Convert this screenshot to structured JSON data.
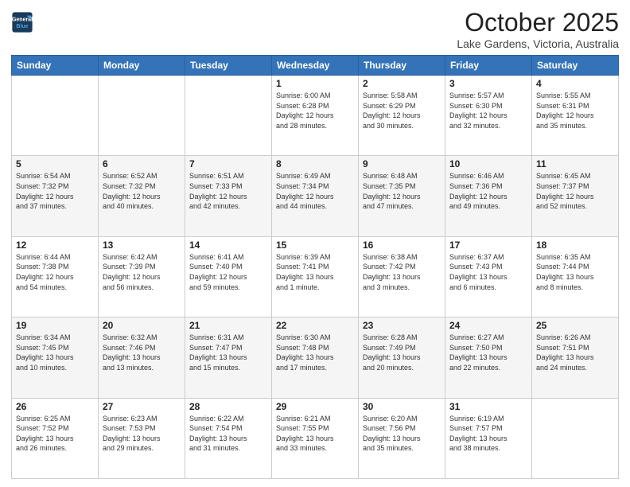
{
  "header": {
    "logo_line1": "General",
    "logo_line2": "Blue",
    "title": "October 2025",
    "subtitle": "Lake Gardens, Victoria, Australia"
  },
  "weekdays": [
    "Sunday",
    "Monday",
    "Tuesday",
    "Wednesday",
    "Thursday",
    "Friday",
    "Saturday"
  ],
  "weeks": [
    [
      {
        "day": "",
        "info": ""
      },
      {
        "day": "",
        "info": ""
      },
      {
        "day": "",
        "info": ""
      },
      {
        "day": "1",
        "info": "Sunrise: 6:00 AM\nSunset: 6:28 PM\nDaylight: 12 hours\nand 28 minutes."
      },
      {
        "day": "2",
        "info": "Sunrise: 5:58 AM\nSunset: 6:29 PM\nDaylight: 12 hours\nand 30 minutes."
      },
      {
        "day": "3",
        "info": "Sunrise: 5:57 AM\nSunset: 6:30 PM\nDaylight: 12 hours\nand 32 minutes."
      },
      {
        "day": "4",
        "info": "Sunrise: 5:55 AM\nSunset: 6:31 PM\nDaylight: 12 hours\nand 35 minutes."
      }
    ],
    [
      {
        "day": "5",
        "info": "Sunrise: 6:54 AM\nSunset: 7:32 PM\nDaylight: 12 hours\nand 37 minutes."
      },
      {
        "day": "6",
        "info": "Sunrise: 6:52 AM\nSunset: 7:32 PM\nDaylight: 12 hours\nand 40 minutes."
      },
      {
        "day": "7",
        "info": "Sunrise: 6:51 AM\nSunset: 7:33 PM\nDaylight: 12 hours\nand 42 minutes."
      },
      {
        "day": "8",
        "info": "Sunrise: 6:49 AM\nSunset: 7:34 PM\nDaylight: 12 hours\nand 44 minutes."
      },
      {
        "day": "9",
        "info": "Sunrise: 6:48 AM\nSunset: 7:35 PM\nDaylight: 12 hours\nand 47 minutes."
      },
      {
        "day": "10",
        "info": "Sunrise: 6:46 AM\nSunset: 7:36 PM\nDaylight: 12 hours\nand 49 minutes."
      },
      {
        "day": "11",
        "info": "Sunrise: 6:45 AM\nSunset: 7:37 PM\nDaylight: 12 hours\nand 52 minutes."
      }
    ],
    [
      {
        "day": "12",
        "info": "Sunrise: 6:44 AM\nSunset: 7:38 PM\nDaylight: 12 hours\nand 54 minutes."
      },
      {
        "day": "13",
        "info": "Sunrise: 6:42 AM\nSunset: 7:39 PM\nDaylight: 12 hours\nand 56 minutes."
      },
      {
        "day": "14",
        "info": "Sunrise: 6:41 AM\nSunset: 7:40 PM\nDaylight: 12 hours\nand 59 minutes."
      },
      {
        "day": "15",
        "info": "Sunrise: 6:39 AM\nSunset: 7:41 PM\nDaylight: 13 hours\nand 1 minute."
      },
      {
        "day": "16",
        "info": "Sunrise: 6:38 AM\nSunset: 7:42 PM\nDaylight: 13 hours\nand 3 minutes."
      },
      {
        "day": "17",
        "info": "Sunrise: 6:37 AM\nSunset: 7:43 PM\nDaylight: 13 hours\nand 6 minutes."
      },
      {
        "day": "18",
        "info": "Sunrise: 6:35 AM\nSunset: 7:44 PM\nDaylight: 13 hours\nand 8 minutes."
      }
    ],
    [
      {
        "day": "19",
        "info": "Sunrise: 6:34 AM\nSunset: 7:45 PM\nDaylight: 13 hours\nand 10 minutes."
      },
      {
        "day": "20",
        "info": "Sunrise: 6:32 AM\nSunset: 7:46 PM\nDaylight: 13 hours\nand 13 minutes."
      },
      {
        "day": "21",
        "info": "Sunrise: 6:31 AM\nSunset: 7:47 PM\nDaylight: 13 hours\nand 15 minutes."
      },
      {
        "day": "22",
        "info": "Sunrise: 6:30 AM\nSunset: 7:48 PM\nDaylight: 13 hours\nand 17 minutes."
      },
      {
        "day": "23",
        "info": "Sunrise: 6:28 AM\nSunset: 7:49 PM\nDaylight: 13 hours\nand 20 minutes."
      },
      {
        "day": "24",
        "info": "Sunrise: 6:27 AM\nSunset: 7:50 PM\nDaylight: 13 hours\nand 22 minutes."
      },
      {
        "day": "25",
        "info": "Sunrise: 6:26 AM\nSunset: 7:51 PM\nDaylight: 13 hours\nand 24 minutes."
      }
    ],
    [
      {
        "day": "26",
        "info": "Sunrise: 6:25 AM\nSunset: 7:52 PM\nDaylight: 13 hours\nand 26 minutes."
      },
      {
        "day": "27",
        "info": "Sunrise: 6:23 AM\nSunset: 7:53 PM\nDaylight: 13 hours\nand 29 minutes."
      },
      {
        "day": "28",
        "info": "Sunrise: 6:22 AM\nSunset: 7:54 PM\nDaylight: 13 hours\nand 31 minutes."
      },
      {
        "day": "29",
        "info": "Sunrise: 6:21 AM\nSunset: 7:55 PM\nDaylight: 13 hours\nand 33 minutes."
      },
      {
        "day": "30",
        "info": "Sunrise: 6:20 AM\nSunset: 7:56 PM\nDaylight: 13 hours\nand 35 minutes."
      },
      {
        "day": "31",
        "info": "Sunrise: 6:19 AM\nSunset: 7:57 PM\nDaylight: 13 hours\nand 38 minutes."
      },
      {
        "day": "",
        "info": ""
      }
    ]
  ]
}
